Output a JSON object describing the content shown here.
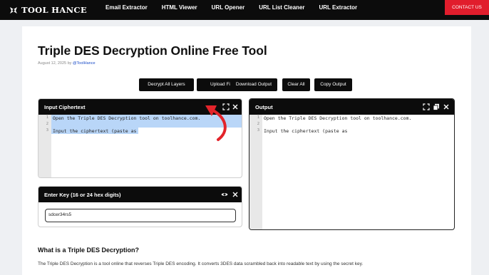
{
  "nav": {
    "logo_text": "TOOL HANCE",
    "links": [
      "Email Extractor",
      "HTML Viewer",
      "URL Opener",
      "URL List Cleaner",
      "URL Extractor"
    ],
    "contact_label": "CONTACT US"
  },
  "page": {
    "title": "Triple DES Decryption Online Free Tool",
    "date": "August 12, 2025 by ",
    "author": "@ToolHance"
  },
  "toolbar": {
    "decrypt_label": "Decrypt All Layers",
    "upload_label": "Upload File",
    "download_label": "Download Output",
    "clear_label": "Clear All",
    "copy_label": "Copy Output"
  },
  "input_panel": {
    "title": "Input Ciphertext",
    "line_numbers": [
      "1",
      "2",
      "3"
    ],
    "lines": [
      "Open the Triple DES Decryption tool on toolhance.com.",
      "",
      "Input the ciphertext (paste as"
    ]
  },
  "output_panel": {
    "title": "Output",
    "line_numbers": [
      "1",
      "2",
      "3"
    ],
    "lines": [
      "Open the Triple DES Decryption tool on toolhance.com.",
      "",
      "Input the ciphertext (paste as"
    ]
  },
  "key_panel": {
    "title": "Enter Key (16 or 24 hex digits)",
    "value": "sdcer34rs5"
  },
  "content": {
    "heading": "What is a Triple DES Decryption?",
    "paragraph": "The Triple DES Decryption is a tool online that reverses Triple DES encoding. It converts 3DES data scrambled back into readable text by using the secret key."
  },
  "colors": {
    "nav_bg": "#0c0c0c",
    "contact_bg": "#e11d2c",
    "selection": "#b9d6f8",
    "annotation_arrow": "#e3242b",
    "author_link": "#1a4cc8"
  },
  "icons": [
    "logo-icon",
    "expand-icon",
    "close-icon",
    "copy-icon",
    "eye-icon"
  ]
}
